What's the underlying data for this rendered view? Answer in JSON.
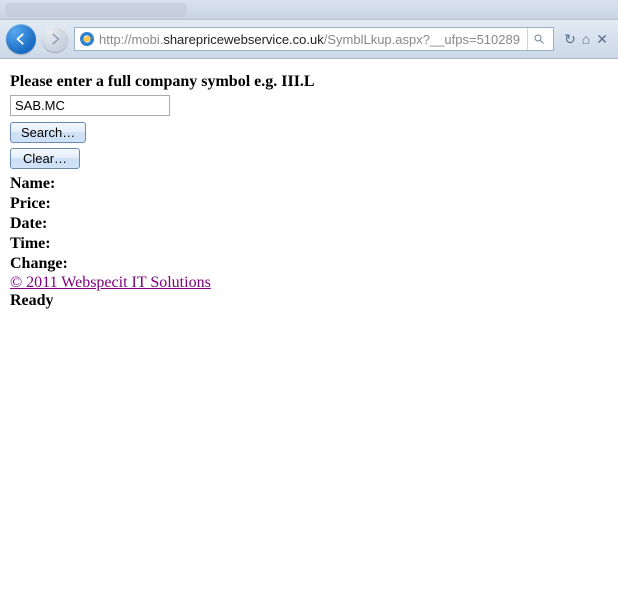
{
  "browser": {
    "url_proto": "http://",
    "url_pre": "mobi.",
    "url_host": "sharepricewebservice.co.uk",
    "url_path": "/SymblLkup.aspx?__ufps=510289",
    "search_hint": "Search"
  },
  "page": {
    "prompt": "Please enter a full company symbol e.g. III.L",
    "symbol_value": "SAB.MC",
    "search_btn": "Search…",
    "clear_btn": "Clear…",
    "labels": {
      "name": "Name:",
      "price": "Price:",
      "date": "Date:",
      "time": "Time:",
      "change": "Change:"
    },
    "footer": "© 2011 Webspecit IT Solutions",
    "status": "Ready"
  }
}
